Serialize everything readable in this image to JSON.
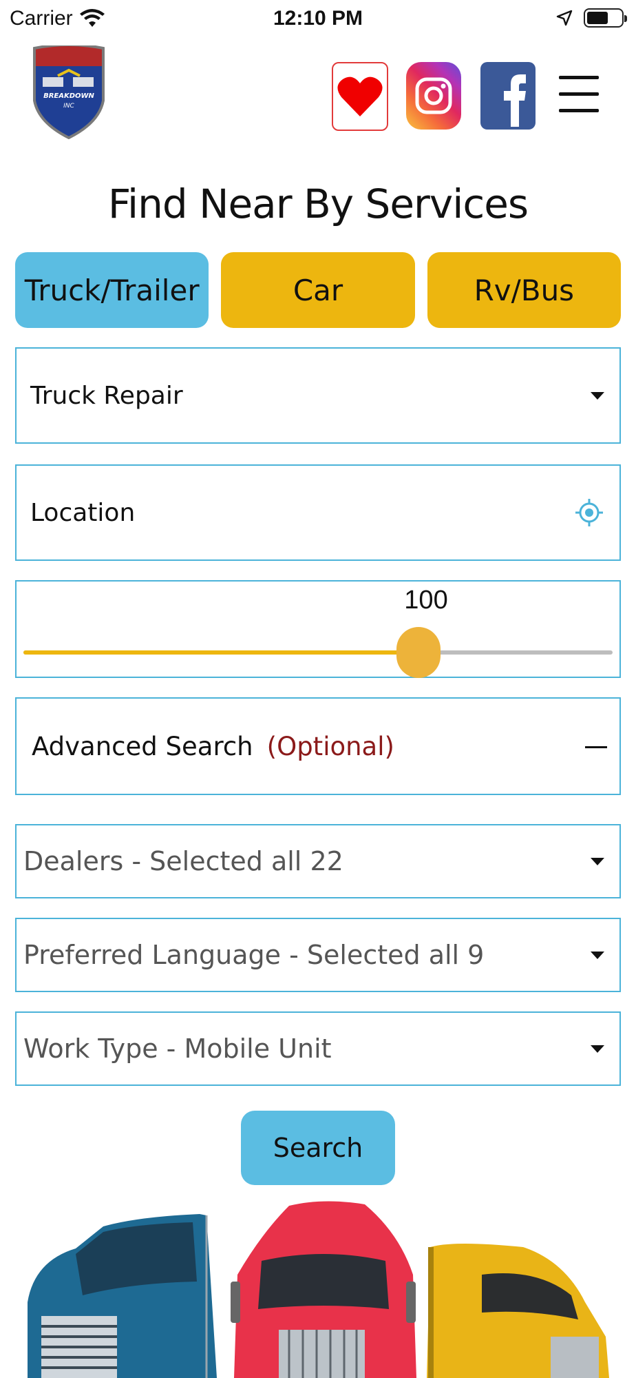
{
  "status_bar": {
    "carrier": "Carrier",
    "time": "12:10 PM"
  },
  "header": {
    "logo_text": "BREAKDOWN INC",
    "icons": [
      "heart-icon",
      "instagram-icon",
      "facebook-icon",
      "menu-icon"
    ]
  },
  "page_title": "Find Near By Services",
  "tabs": [
    {
      "label": "Truck/Trailer",
      "active": true
    },
    {
      "label": "Car",
      "active": false
    },
    {
      "label": "Rv/Bus",
      "active": false
    }
  ],
  "form": {
    "service_type": "Truck Repair",
    "location_placeholder": "Location",
    "radius_value": "100",
    "radius_fraction": 0.67,
    "advanced_search_label": "Advanced Search",
    "advanced_search_optional": "(Optional)",
    "dealers": "Dealers - Selected all 22",
    "preferred_language": "Preferred Language - Selected all 9",
    "work_type": "Work Type - Mobile Unit",
    "search_label": "Search"
  },
  "colors": {
    "tab_active": "#5bbde2",
    "tab_inactive": "#edb60f",
    "field_border": "#4bb3d9",
    "optional_text": "#8b1a1a",
    "slider_fill": "#edb60f",
    "slider_thumb": "#edb33a"
  }
}
